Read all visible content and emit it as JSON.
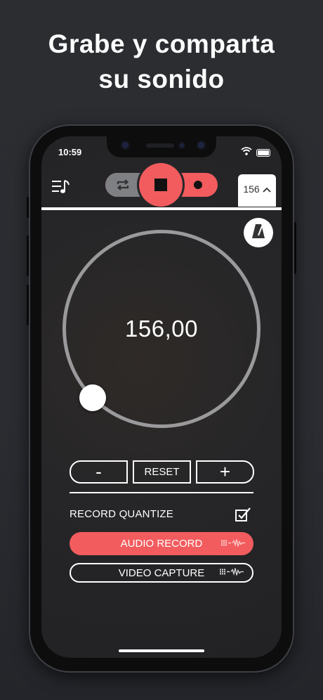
{
  "headline": {
    "line1": "Grabe y comparta",
    "line2": "su sonido"
  },
  "status_bar": {
    "time": "10:59"
  },
  "toolbar": {
    "tempo_tab_label": "156"
  },
  "dial": {
    "value_text": "156,00"
  },
  "controls": {
    "minus_label": "-",
    "reset_label": "RESET",
    "plus_label": "+"
  },
  "record_quantize": {
    "label": "RECORD QUANTIZE",
    "checked": true
  },
  "actions": {
    "audio_record_label": "AUDIO RECORD",
    "video_capture_label": "VIDEO CAPTURE"
  },
  "icons": {
    "menu": "music-list-icon",
    "loop": "loop-icon",
    "stop": "stop-icon",
    "record": "record-dot-icon",
    "tab": "chevron-up-icon",
    "metronome": "metronome-icon",
    "waveform": "waveform-icon",
    "wifi": "wifi-icon",
    "battery": "battery-icon",
    "checkbox": "checkbox-checked-icon"
  },
  "colors": {
    "accent": "#f25c5e",
    "background": "#2b2d31",
    "screen": "#262628",
    "dial_track": "#9a9a9c"
  }
}
